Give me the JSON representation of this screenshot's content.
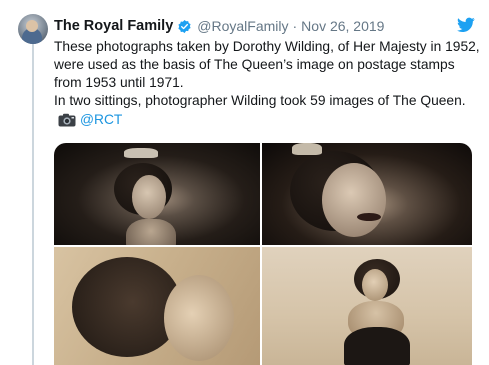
{
  "tweet": {
    "author_name": "The Royal Family",
    "handle": "@RoyalFamily",
    "separator": "·",
    "date": "Nov 26, 2019",
    "text_line1": "These photographs taken by Dorothy Wilding, of Her Majesty in 1952, were used as the basis of The Queen’s image on postage stamps from 1953 until 1971.",
    "text_line2": "In two sittings, photographer Wilding took 59 images of The Queen.",
    "credit_mention": "@RCT"
  },
  "icons": {
    "verified": "verified-badge-icon",
    "platform": "twitter-bird-icon",
    "camera": "camera-emoji-icon"
  },
  "colors": {
    "verified_blue": "#1da1f2",
    "twitter_blue": "#1da1f2",
    "link_blue": "#1b95e0",
    "muted_gray": "#657786",
    "thread_line": "#ccd6dd"
  },
  "media": {
    "photo_count": 4
  }
}
